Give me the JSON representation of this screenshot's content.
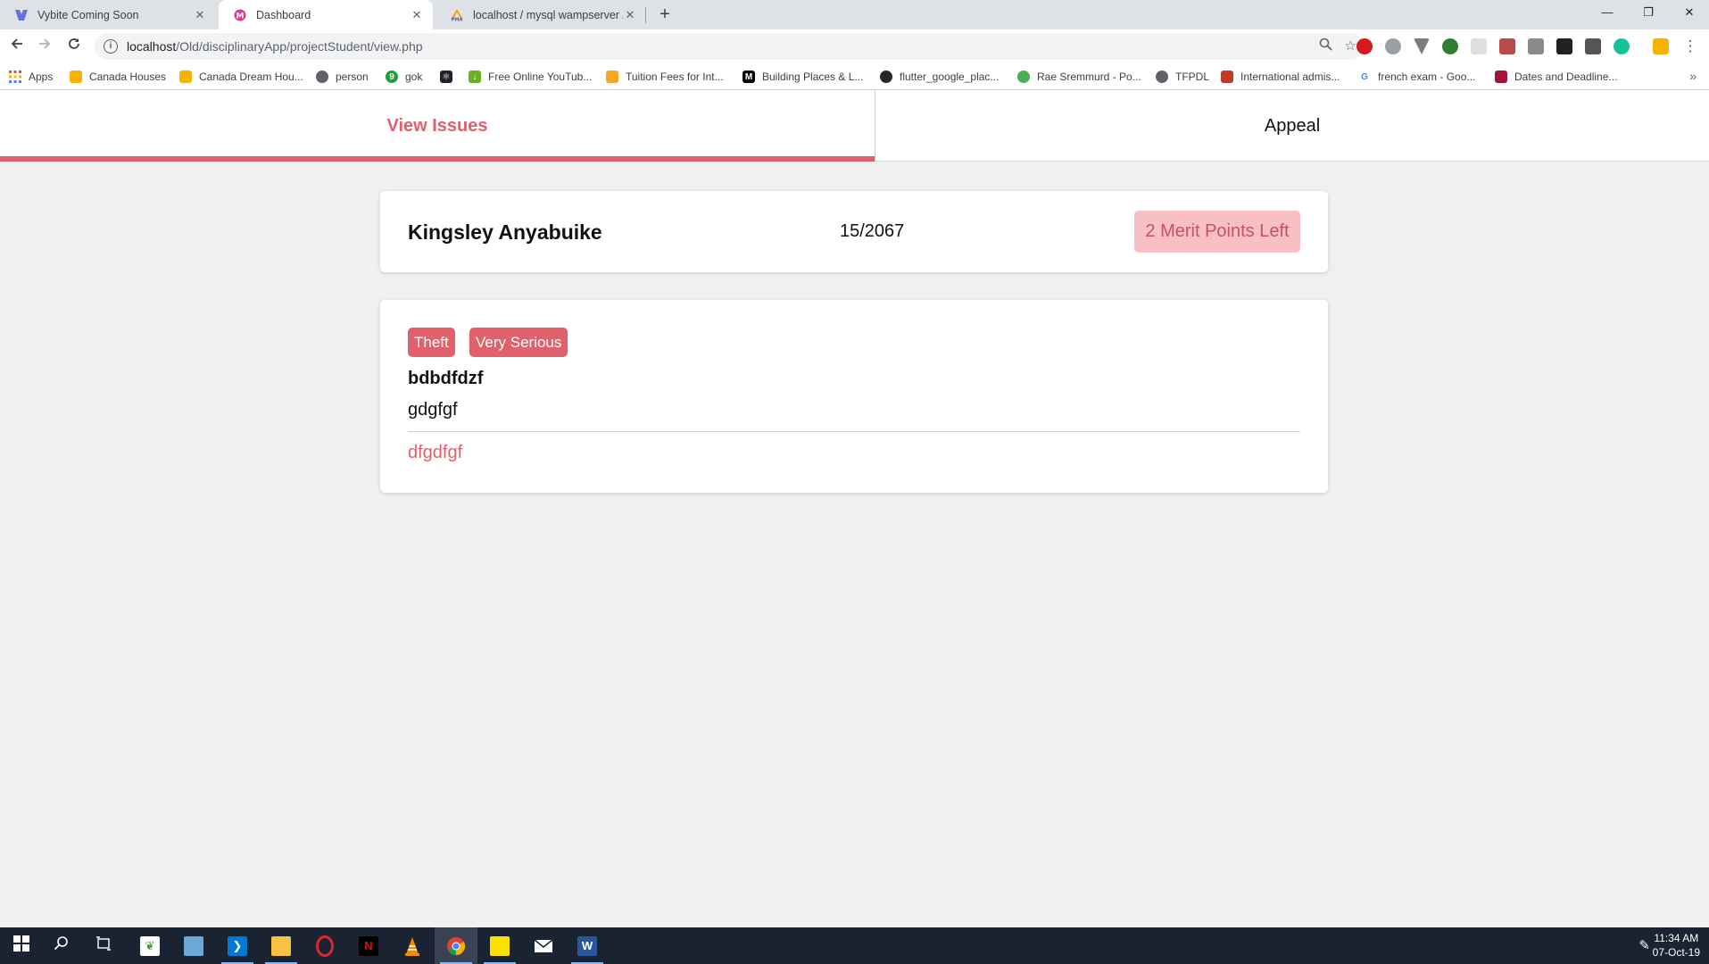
{
  "browser": {
    "tabs": [
      {
        "title": "Vybite Coming Soon",
        "active": false
      },
      {
        "title": "Dashboard",
        "active": true
      },
      {
        "title": "localhost / mysql wampserver / s",
        "active": false
      }
    ],
    "url_host": "localhost",
    "url_path": "/Old/disciplinaryApp/projectStudent/view.php",
    "bookmarks": [
      {
        "label": "Apps"
      },
      {
        "label": "Canada Houses"
      },
      {
        "label": "Canada Dream Hou..."
      },
      {
        "label": "person"
      },
      {
        "label": "gok"
      },
      {
        "label": ""
      },
      {
        "label": "Free Online YouTub..."
      },
      {
        "label": "Tuition Fees for Int..."
      },
      {
        "label": "Building Places & L..."
      },
      {
        "label": "flutter_google_plac..."
      },
      {
        "label": "Rae Sremmurd - Po..."
      },
      {
        "label": "TFPDL"
      },
      {
        "label": "International admis..."
      },
      {
        "label": "french exam - Goo..."
      },
      {
        "label": "Dates and Deadline..."
      }
    ]
  },
  "nav": {
    "tabs": [
      {
        "label": "View Issues",
        "active": true
      },
      {
        "label": "Appeal",
        "active": false
      }
    ]
  },
  "student": {
    "name": "Kingsley Anyabuike",
    "id": "15/2067",
    "merit": "2 Merit Points Left"
  },
  "issue": {
    "tags": [
      "Theft",
      "Very Serious"
    ],
    "title": "bdbdfdzf",
    "description": "gdgfgf",
    "link": "dfgdfgf"
  },
  "taskbar": {
    "time": "11:34 AM",
    "date": "07-Oct-19"
  },
  "colors": {
    "accent": "#e2606b",
    "badge_bg": "#f8bfc4",
    "badge_text": "#c3545f",
    "page_bg": "#f0f0f0"
  }
}
